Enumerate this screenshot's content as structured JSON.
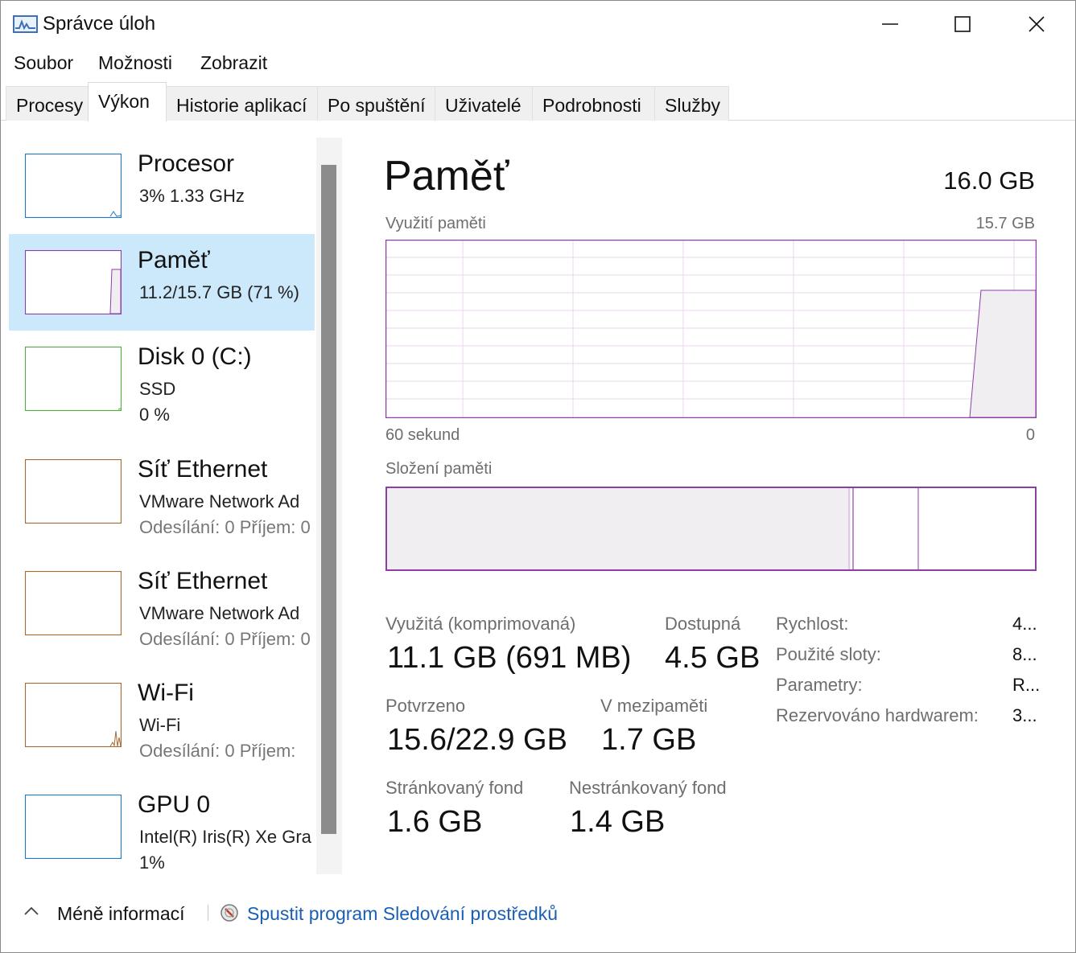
{
  "window": {
    "title": "Správce úloh"
  },
  "menu": {
    "items": [
      "Soubor",
      "Možnosti",
      "Zobrazit"
    ]
  },
  "tabs": [
    "Procesy",
    "Výkon",
    "Historie aplikací",
    "Po spuštění",
    "Uživatelé",
    "Podrobnosti",
    "Služby"
  ],
  "active_tab": "Výkon",
  "sidebar": {
    "items": [
      {
        "name": "Procesor",
        "line1": "3%  1.33 GHz",
        "line2": "",
        "color": "#1e77c7"
      },
      {
        "name": "Paměť",
        "line1": "11.2/15.7 GB (71 %)",
        "line2": "",
        "color": "#8b3ea6"
      },
      {
        "name": "Disk 0 (C:)",
        "line1": "SSD",
        "line2": "0 %",
        "color": "#4caf39"
      },
      {
        "name": "Síť Ethernet",
        "line1": "VMware Network Ad",
        "line2": "Odesílání: 0  Příjem: 0",
        "color": "#a7692f"
      },
      {
        "name": "Síť Ethernet",
        "line1": "VMware Network Ad",
        "line2": "Odesílání: 0  Příjem: 0",
        "color": "#a7692f"
      },
      {
        "name": "Wi-Fi",
        "line1": "Wi-Fi",
        "line2": "Odesílání: 0  Příjem:",
        "color": "#a7692f"
      },
      {
        "name": "GPU 0",
        "line1": "Intel(R) Iris(R) Xe Gra",
        "line2": "1%",
        "color": "#1e77c7"
      }
    ]
  },
  "main": {
    "title": "Paměť",
    "total": "16.0 GB",
    "usage_label": "Využití paměti",
    "usage_max": "15.7 GB",
    "axis_left": "60 sekund",
    "axis_right": "0",
    "composition_label": "Složení paměti",
    "stats": {
      "used_label": "Využitá (komprimovaná)",
      "used_value": "11.1 GB (691 MB)",
      "available_label": "Dostupná",
      "available_value": "4.5 GB",
      "committed_label": "Potvrzeno",
      "committed_value": "15.6/22.9 GB",
      "cached_label": "V mezipaměti",
      "cached_value": "1.7 GB",
      "paged_label": "Stránkovaný fond",
      "paged_value": "1.6 GB",
      "nonpaged_label": "Nestránkovaný fond",
      "nonpaged_value": "1.4 GB"
    },
    "details": [
      {
        "key": "Rychlost:",
        "value": "4..."
      },
      {
        "key": "Použité sloty:",
        "value": "8..."
      },
      {
        "key": "Parametry:",
        "value": "R..."
      },
      {
        "key": "Rezervováno hardwarem:",
        "value": "3..."
      }
    ]
  },
  "footer": {
    "less_label": "Méně informací",
    "resmon_label": "Spustit program Sledování prostředků"
  },
  "colors": {
    "memory": "#8b3ea6",
    "memory_fill": "#f1eef2",
    "selected": "#cce8fb",
    "link": "#1a5fb4"
  }
}
